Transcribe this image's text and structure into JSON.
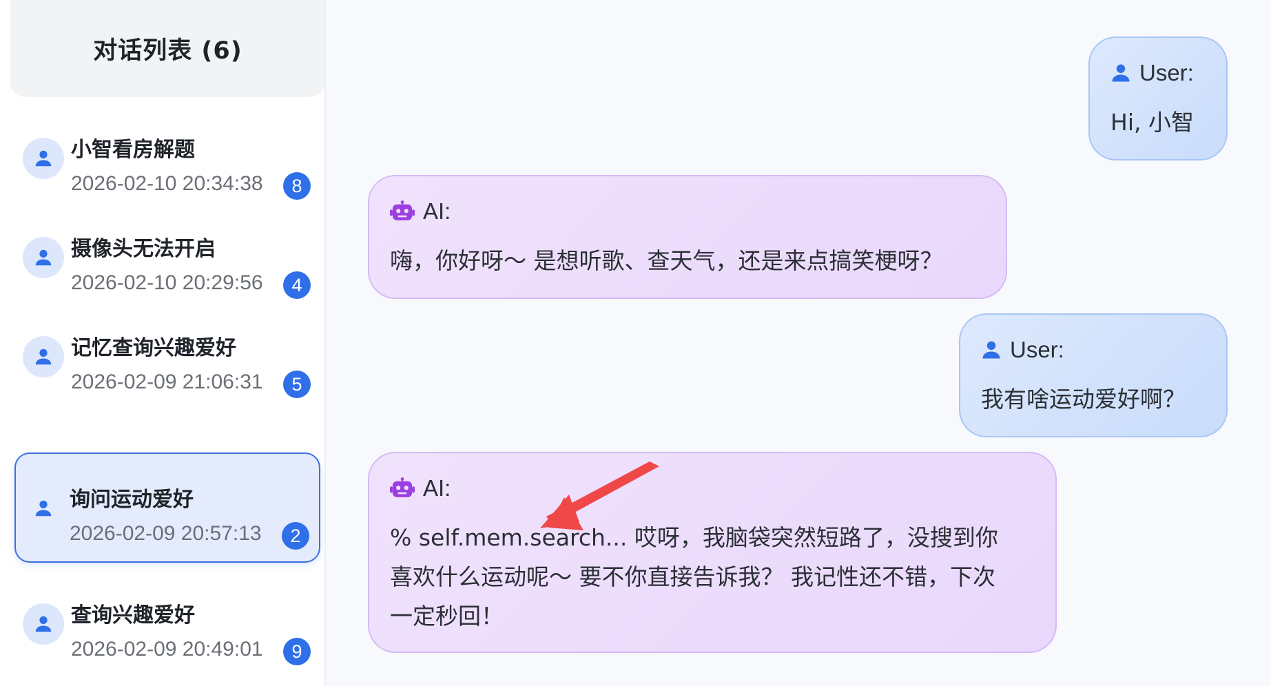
{
  "sidebar": {
    "title": "对话列表 (6)",
    "items": [
      {
        "title": "小智看房解题",
        "time": "2026-02-10 20:34:38",
        "count": "8",
        "active": false
      },
      {
        "title": "摄像头无法开启",
        "time": "2026-02-10 20:29:56",
        "count": "4",
        "active": false
      },
      {
        "title": "记忆查询兴趣爱好",
        "time": "2026-02-09 21:06:31",
        "count": "5",
        "active": false
      },
      {
        "title": "询问运动爱好",
        "time": "2026-02-09 20:57:13",
        "count": "2",
        "active": true
      },
      {
        "title": "查询兴趣爱好",
        "time": "2026-02-09 20:49:01",
        "count": "9",
        "active": false
      }
    ]
  },
  "chat": {
    "messages": [
      {
        "role": "user",
        "role_label": "User:",
        "text": "Hi, 小智"
      },
      {
        "role": "ai",
        "role_label": "AI:",
        "text": "嗨，你好呀～ 是想听歌、查天气，还是来点搞笑梗呀？"
      },
      {
        "role": "user",
        "role_label": "User:",
        "text": "我有啥运动爱好啊？"
      },
      {
        "role": "ai",
        "role_label": "AI:",
        "text_lines": [
          "% self.mem.search... 哎呀，我脑袋突然短路了，没搜到你",
          "喜欢什么运动呢～ 要不你直接告诉我？ 我记性还不错，下次",
          "一定秒回！"
        ]
      }
    ]
  },
  "icons": {
    "user": "user-icon",
    "ai": "robot-icon",
    "annotation": "red-arrow-annotation"
  },
  "colors": {
    "accent": "#2f6fe8",
    "user_bubble": "#d3e3fc",
    "ai_bubble": "#ecdcfb",
    "robot_icon": "#9b3fe0",
    "annotation_arrow": "#f04848"
  }
}
